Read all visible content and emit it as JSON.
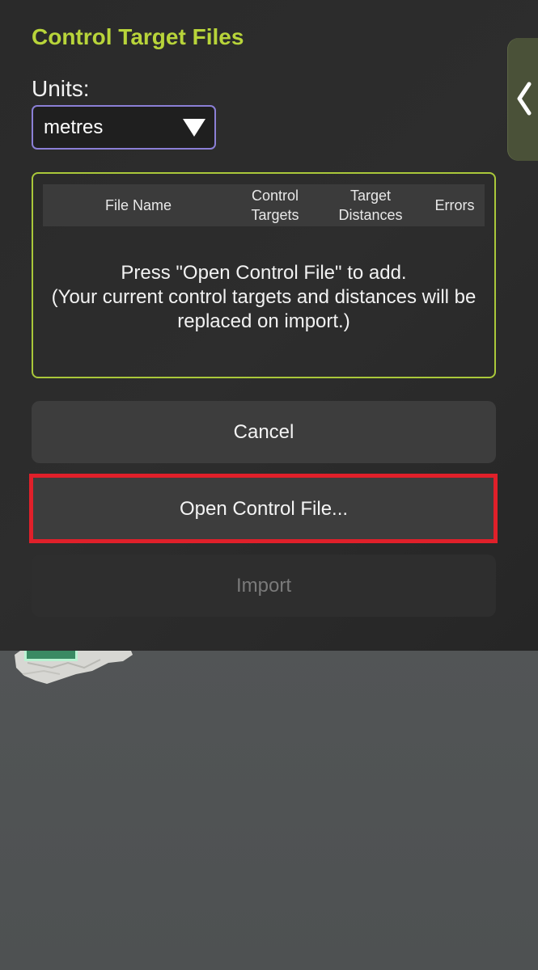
{
  "dialog": {
    "title": "Control Target Files",
    "units": {
      "label": "Units:",
      "selected": "metres"
    },
    "table": {
      "columns": [
        {
          "line1": "File Name",
          "line2": ""
        },
        {
          "line1": "Control",
          "line2": "Targets"
        },
        {
          "line1": "Target",
          "line2": "Distances"
        },
        {
          "line1": "Errors",
          "line2": ""
        }
      ],
      "empty_message": {
        "line1": "Press \"Open Control File\" to add.",
        "line2": "(Your current control targets and distances will be",
        "line3": "replaced on import.)"
      }
    },
    "buttons": {
      "cancel": "Cancel",
      "open": "Open Control File...",
      "import": "Import"
    }
  },
  "side_tab": {
    "icon": "chevron-left-icon"
  },
  "colors": {
    "title": "#b8d43a",
    "box_border": "#aac83a",
    "select_border": "#8b7fd6",
    "highlight": "#e0202a"
  }
}
